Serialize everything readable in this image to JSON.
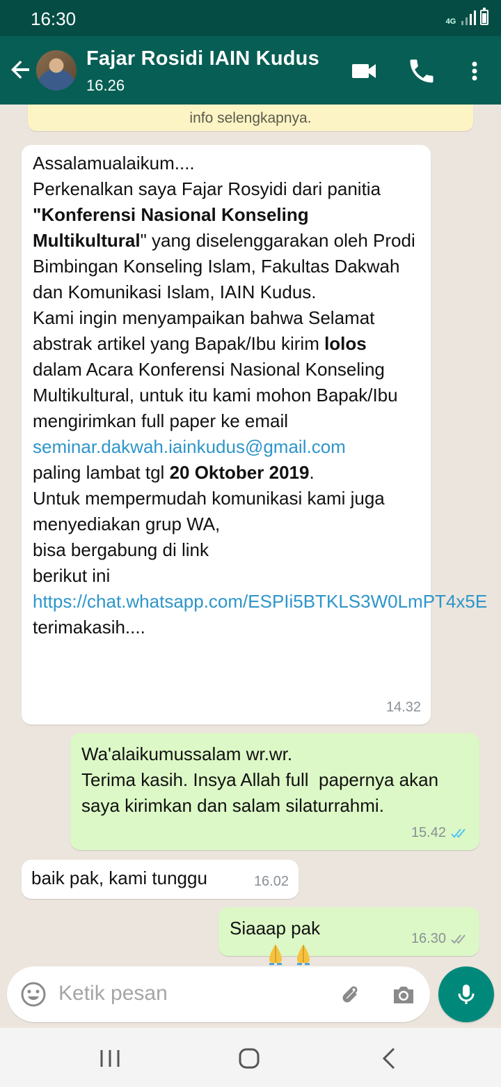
{
  "status_bar": {
    "time": "16:30",
    "network": "4G"
  },
  "header": {
    "contact_name": "Fajar Rosidi IAIN Kudus",
    "subtitle": "16.26"
  },
  "info_banner": {
    "text": "info selengkapnya."
  },
  "messages": [
    {
      "direction": "incoming",
      "time": "14.32",
      "parts": [
        "Assalamualaikum....",
        "Perkenalkan saya Fajar Rosyidi dari panitia ",
        "\"Konferensi Nasional Konseling Multikultural",
        "\" yang diselenggarakan oleh Prodi Bimbingan Konseling Islam, Fakultas Dakwah dan Komunikasi Islam, IAIN Kudus.",
        "Kami ingin menyampaikan bahwa Selamat abstrak artikel yang Bapak/Ibu kirim ",
        "lolos",
        " dalam Acara Konferensi Nasional Konseling Multikultural, untuk itu kami mohon Bapak/Ibu mengirimkan full paper ke email",
        "seminar.dakwah.iainkudus@gmail.com",
        "paling lambat tgl ",
        "20 Oktober 2019",
        ".",
        "Untuk mempermudah komunikasi kami juga menyediakan grup WA,",
        "bisa bergabung di link",
        "berikut ini",
        "https://chat.whatsapp.com/ESPIi5BTKLS3W0LmPT4x5E",
        "terimakasih...."
      ]
    },
    {
      "direction": "outgoing",
      "time": "15.42",
      "status": "read",
      "text": "Wa'alaikumussalam wr.wr.\nTerima kasih. Insya Allah full  papernya akan saya kirimkan dan salam silaturrahmi."
    },
    {
      "direction": "incoming",
      "time": "16.02",
      "text": "baik pak, kami tunggu"
    },
    {
      "direction": "outgoing",
      "time": "16.30",
      "status": "delivered",
      "text": "Siaaap pak"
    }
  ],
  "input": {
    "placeholder": "Ketik pesan"
  },
  "colors": {
    "header": "#075E54",
    "status_bar": "#054D44",
    "outgoing_bubble": "#DCF8C6",
    "link": "#2E95C9",
    "accent": "#00897B"
  }
}
